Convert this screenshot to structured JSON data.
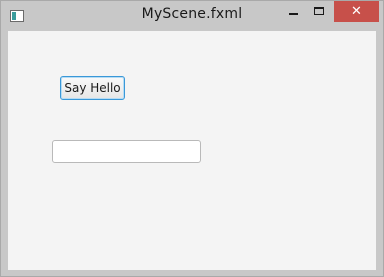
{
  "window": {
    "title": "MyScene.fxml",
    "close_glyph": "✕"
  },
  "main": {
    "say_hello_label": "Say Hello",
    "text_field_value": ""
  },
  "colors": {
    "close_button": "#c7504a",
    "content_background": "#f4f4f4",
    "focus_border": "#3a98d8"
  },
  "icons": {
    "app": "app-window-icon",
    "minimize": "minimize-icon",
    "maximize": "maximize-icon",
    "close": "close-icon"
  }
}
